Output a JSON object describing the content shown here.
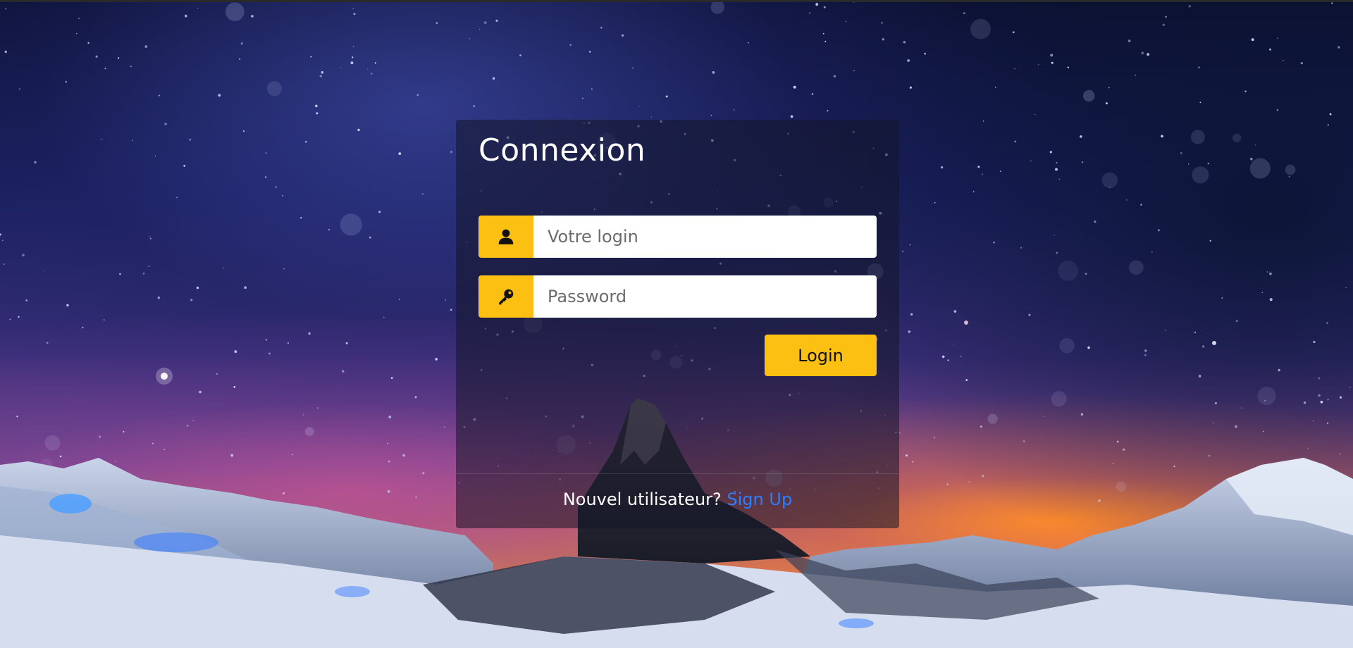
{
  "login_panel": {
    "title": "Connexion",
    "login_field": {
      "placeholder": "Votre login",
      "value": ""
    },
    "password_field": {
      "placeholder": "Password",
      "value": ""
    },
    "login_button_label": "Login",
    "footer": {
      "question": "Nouvel utilisateur?",
      "signup_link_label": "Sign Up"
    }
  },
  "icons": {
    "login_field_icon": "user-icon",
    "password_field_icon": "key-icon"
  },
  "colors": {
    "accent": "#fbc012",
    "link": "#2f7dff",
    "panel_background": "rgba(20,22,40,0.55)"
  }
}
